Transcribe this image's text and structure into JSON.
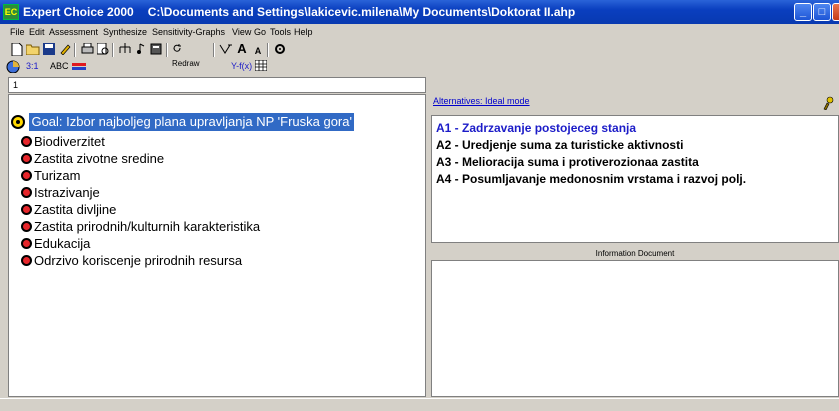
{
  "window": {
    "app_name": "Expert Choice 2000",
    "file_path": "C:\\Documents and Settings\\lakicevic.milena\\My Documents\\Doktorat II.ahp",
    "icon_text": "EC",
    "minimize": "_",
    "maximize": "□",
    "close": "X"
  },
  "menu": {
    "file": "File",
    "edit": "Edit",
    "assessment": "Assessment",
    "synthesize": "Synthesize",
    "sensitivity": "Sensitivity-Graphs",
    "view": "View",
    "go": "Go",
    "tools": "Tools",
    "help": "Help"
  },
  "toolbar": {
    "redraw": "Redraw",
    "bigger_font": "A",
    "smaller_font": "A",
    "mode_31": "3:1",
    "mode_abc": "ABC",
    "yfx": "Y-f(x)"
  },
  "left": {
    "level": "1",
    "goal": "Goal: Izbor najboljeg plana upravljanja NP 'Fruska gora'",
    "criteria": [
      "Biodiverzitet",
      "Zastita zivotne sredine",
      "Turizam",
      "Istrazivanje",
      "Zastita divljine",
      "Zastita prirodnih/kulturnih karakteristika",
      "Edukacija",
      "Odrzivo koriscenje prirodnih resursa"
    ]
  },
  "right": {
    "alternatives_link": "Alternatives: Ideal mode",
    "alternatives": [
      "A1 - Zadrzavanje postojeceg stanja",
      "A2 - Uredjenje suma za turisticke aktivnosti",
      "A3 - Melioracija suma i protiverozionaa zastita",
      "A4 - Posumljavanje medonosnim vrstama i razvoj polj."
    ],
    "info_title": "Information Document"
  }
}
